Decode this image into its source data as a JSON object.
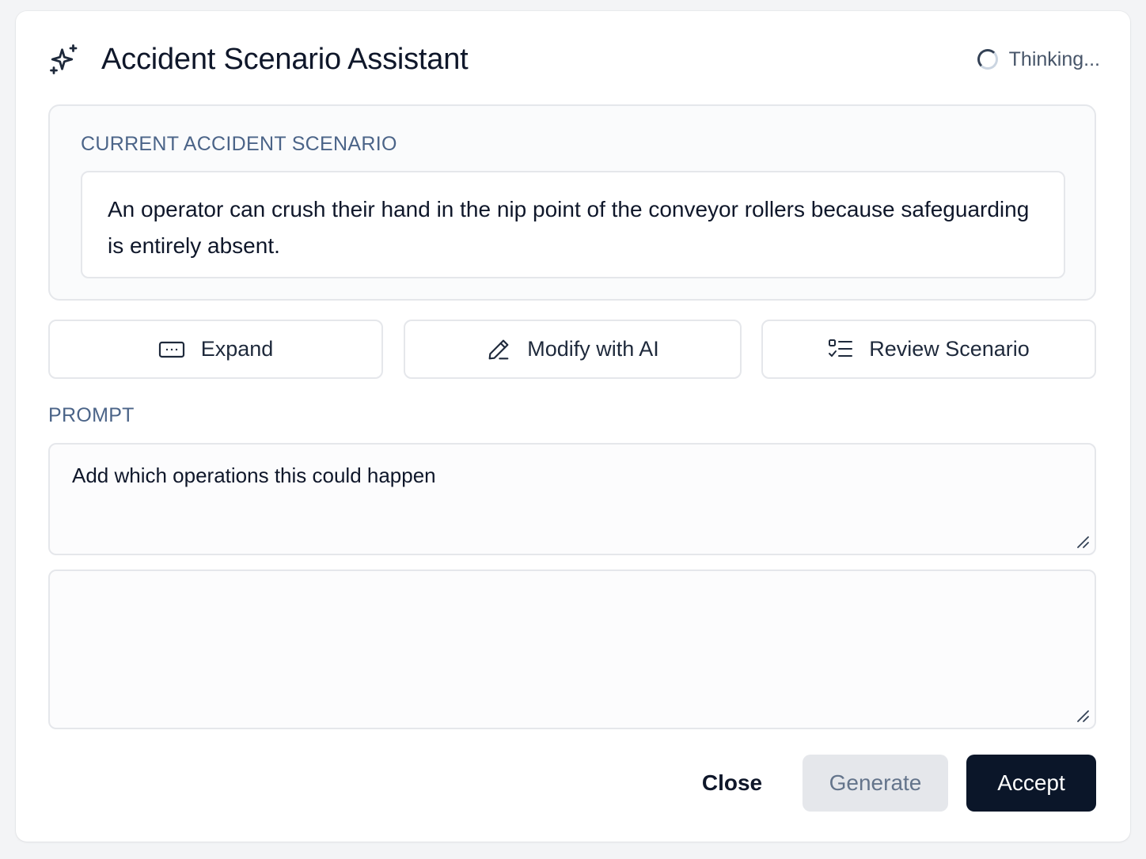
{
  "dialog": {
    "title": "Accident Scenario Assistant",
    "title_icon": "sparkles-icon",
    "status_text": "Thinking..."
  },
  "scenario": {
    "label": "CURRENT ACCIDENT SCENARIO",
    "text": "An operator can crush their hand in the nip point of the conveyor rollers because safeguarding is entirely absent."
  },
  "actions": {
    "expand": {
      "label": "Expand",
      "icon": "expand-icon"
    },
    "modify": {
      "label": "Modify with AI",
      "icon": "pencil-icon"
    },
    "review": {
      "label": "Review Scenario",
      "icon": "checklist-icon"
    }
  },
  "prompt": {
    "label": "PROMPT",
    "value": "Add which operations this could happen"
  },
  "output": {
    "value": ""
  },
  "footer": {
    "close_label": "Close",
    "generate_label": "Generate",
    "accept_label": "Accept"
  },
  "colors": {
    "accent_dark": "#0b1629",
    "section_label": "#4b6488",
    "disabled_bg": "#e5e7eb"
  }
}
